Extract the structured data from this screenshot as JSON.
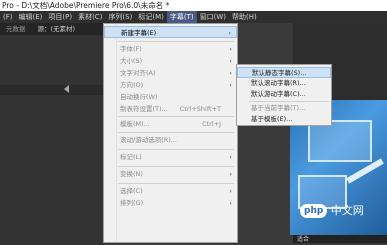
{
  "window": {
    "title": "Pro - D:\\文档\\Adobe\\Premiere Pro\\6.0\\未命名 *"
  },
  "menubar": [
    {
      "label": "(F)"
    },
    {
      "label": "编辑(E)"
    },
    {
      "label": "项目(P)"
    },
    {
      "label": "素材(C)"
    },
    {
      "label": "序列(S)"
    },
    {
      "label": "标记(M)"
    },
    {
      "label": "字幕(T)",
      "active": true
    },
    {
      "label": "窗口(W)"
    },
    {
      "label": "帮助(H)"
    }
  ],
  "panel": {
    "tabs": [
      "元数据",
      "源：(无素材)"
    ]
  },
  "title_menu": {
    "items": [
      {
        "label": "新建字幕(E)",
        "highlight": true,
        "arrow": true
      },
      {
        "sep": true
      },
      {
        "label": "字体(F)",
        "disabled": true,
        "arrow": true
      },
      {
        "label": "大小(S)",
        "disabled": true,
        "arrow": true
      },
      {
        "label": "文字对齐(A)",
        "disabled": true,
        "arrow": true
      },
      {
        "label": "方向(O)",
        "disabled": true,
        "arrow": true
      },
      {
        "label": "自动换行(W)",
        "disabled": true
      },
      {
        "label": "制表符设置(T)...",
        "disabled": true,
        "shortcut": "Ctrl+Shift+T"
      },
      {
        "sep": true
      },
      {
        "label": "模板(M)...",
        "disabled": true,
        "shortcut": "Ctrl+J"
      },
      {
        "sep": true
      },
      {
        "label": "滚动/游动选项(R)...",
        "disabled": true
      },
      {
        "sep": true
      },
      {
        "label": "标记(L)",
        "disabled": true,
        "arrow": true
      },
      {
        "sep": true
      },
      {
        "label": "变换(N)",
        "disabled": true,
        "arrow": true
      },
      {
        "sep": true
      },
      {
        "label": "选择(C)",
        "disabled": true,
        "arrow": true
      },
      {
        "label": "排列(G)",
        "disabled": true,
        "arrow": true
      }
    ]
  },
  "new_title_submenu": {
    "items": [
      {
        "label": "默认静态字幕(S)...",
        "highlight": true
      },
      {
        "label": "默认滚动字幕(R)..."
      },
      {
        "label": "默认游动字幕(C)..."
      },
      {
        "sep": true
      },
      {
        "label": "基于当前字幕(T)...",
        "disabled": true
      },
      {
        "label": "基于模板(E)..."
      }
    ]
  },
  "monitor": {
    "tab_label": "适合"
  },
  "watermark": {
    "logo": "php",
    "text": "中文网"
  }
}
